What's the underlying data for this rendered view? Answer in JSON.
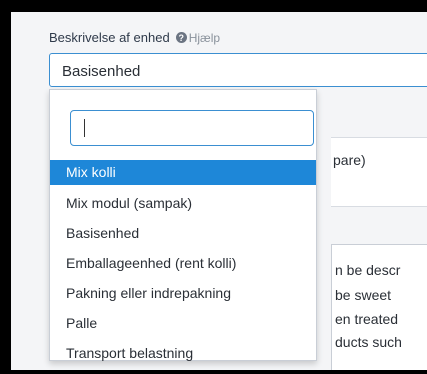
{
  "field": {
    "label": "Beskrivelse af enhed",
    "help_icon_glyph": "?",
    "help_text": "Hjælp",
    "selected_value": "Basisenhed"
  },
  "dropdown": {
    "search_value": "",
    "options": [
      "Mix kolli",
      "Mix modul (sampak)",
      "Basisenhed",
      "Emballageenhed (rent kolli)",
      "Pakning eller indrepakning",
      "Palle",
      "Transport belastning"
    ],
    "highlighted_index": 0
  },
  "background": {
    "text_1": "pare)",
    "lines": [
      "n be descr",
      "be sweet",
      "en treated",
      "ducts such"
    ]
  },
  "colors": {
    "accent": "#1e87d8",
    "focus_border": "#3b8fd1"
  }
}
